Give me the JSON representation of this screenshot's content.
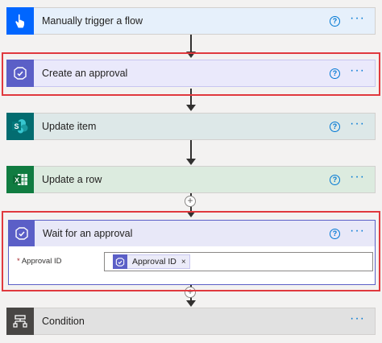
{
  "steps": {
    "trigger": {
      "title": "Manually trigger a flow",
      "icon": "hand-pointer-icon",
      "color": "#0066ff",
      "bg": "#e6f0fb"
    },
    "create_approval": {
      "title": "Create an approval",
      "icon": "approval-icon",
      "color": "#5b5fc7",
      "bg": "#eae9fb"
    },
    "update_item": {
      "title": "Update item",
      "icon": "sharepoint-icon",
      "color": "#036c70",
      "bg": "#dde8e8"
    },
    "update_row": {
      "title": "Update a row",
      "icon": "excel-icon",
      "color": "#107c41",
      "bg": "#dcebdf"
    },
    "wait_approval": {
      "title": "Wait for an approval",
      "icon": "approval-icon",
      "color": "#5b5fc7",
      "field_required_mark": "*",
      "field_label": "Approval ID",
      "token_label": "Approval ID",
      "token_remove": "×"
    },
    "condition": {
      "title": "Condition",
      "icon": "condition-icon",
      "color": "#484644",
      "bg": "#e1e1e1"
    }
  },
  "common": {
    "help_label": "?",
    "more_label": "···",
    "add_label": "+"
  },
  "highlight_color": "#e0393e"
}
